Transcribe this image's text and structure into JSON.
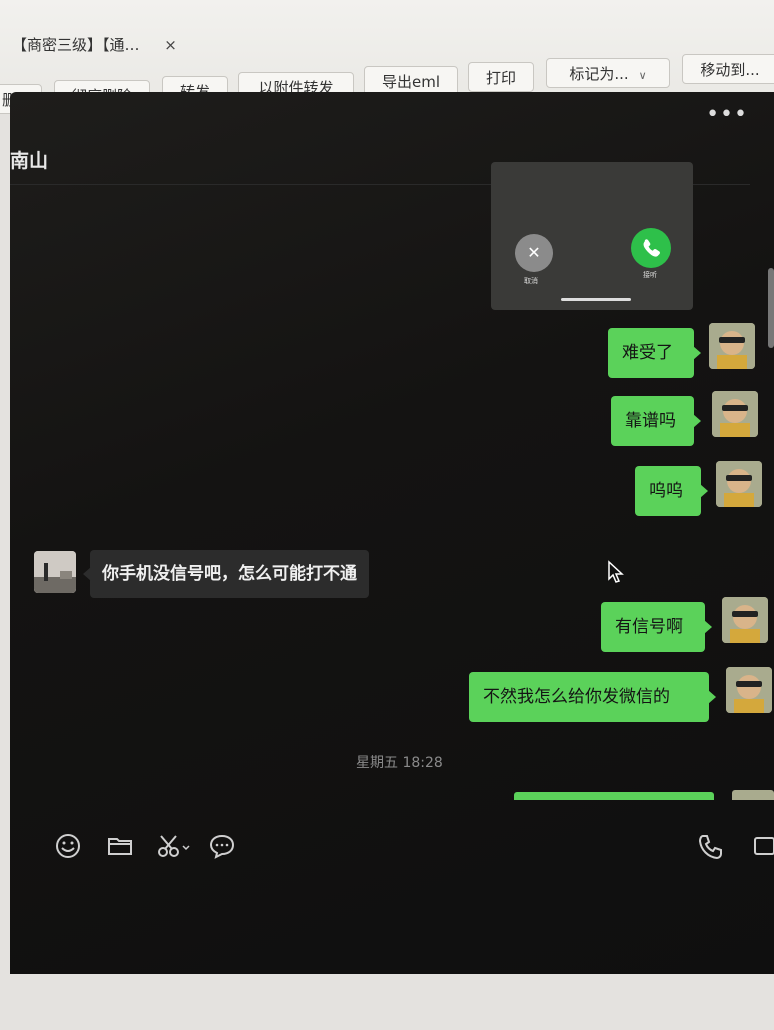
{
  "mail": {
    "tab_label": "【商密三级】【通…",
    "tab_close": "×",
    "toolbar": [
      {
        "id": "delete",
        "label": "删除"
      },
      {
        "id": "perm-delete",
        "label": "彻底删除"
      },
      {
        "id": "forward",
        "label": "转发"
      },
      {
        "id": "forward-attach",
        "label": "以附件转发"
      },
      {
        "id": "export",
        "label": "导出eml"
      },
      {
        "id": "print",
        "label": "打印"
      },
      {
        "id": "mark",
        "label": "标记为..."
      },
      {
        "id": "move",
        "label": "移动到..."
      }
    ]
  },
  "chat": {
    "title": "南山",
    "more": "•••",
    "call": {
      "cancel_label": "取消",
      "answer_label": "接听"
    },
    "messages": [
      {
        "side": "out",
        "text": "难受了"
      },
      {
        "side": "out",
        "text": "靠谱吗"
      },
      {
        "side": "out",
        "text": "呜呜"
      },
      {
        "side": "in",
        "text": "你手机没信号吧，怎么可能打不通"
      },
      {
        "side": "out",
        "text": "有信号啊"
      },
      {
        "side": "out",
        "text": "不然我怎么给你发微信的"
      }
    ],
    "timestamp": "星期五 18:28"
  },
  "icons": [
    "emoji-icon",
    "folder-icon",
    "scissors-icon",
    "chat-bubble-icon",
    "phone-icon",
    "video-icon",
    "cursor-icon",
    "more-icon"
  ],
  "colors": {
    "bubble_out": "#5bd25a",
    "bubble_in": "#2c2c2c",
    "chat_bg": "#141312",
    "call_answer": "#2ec04a"
  }
}
